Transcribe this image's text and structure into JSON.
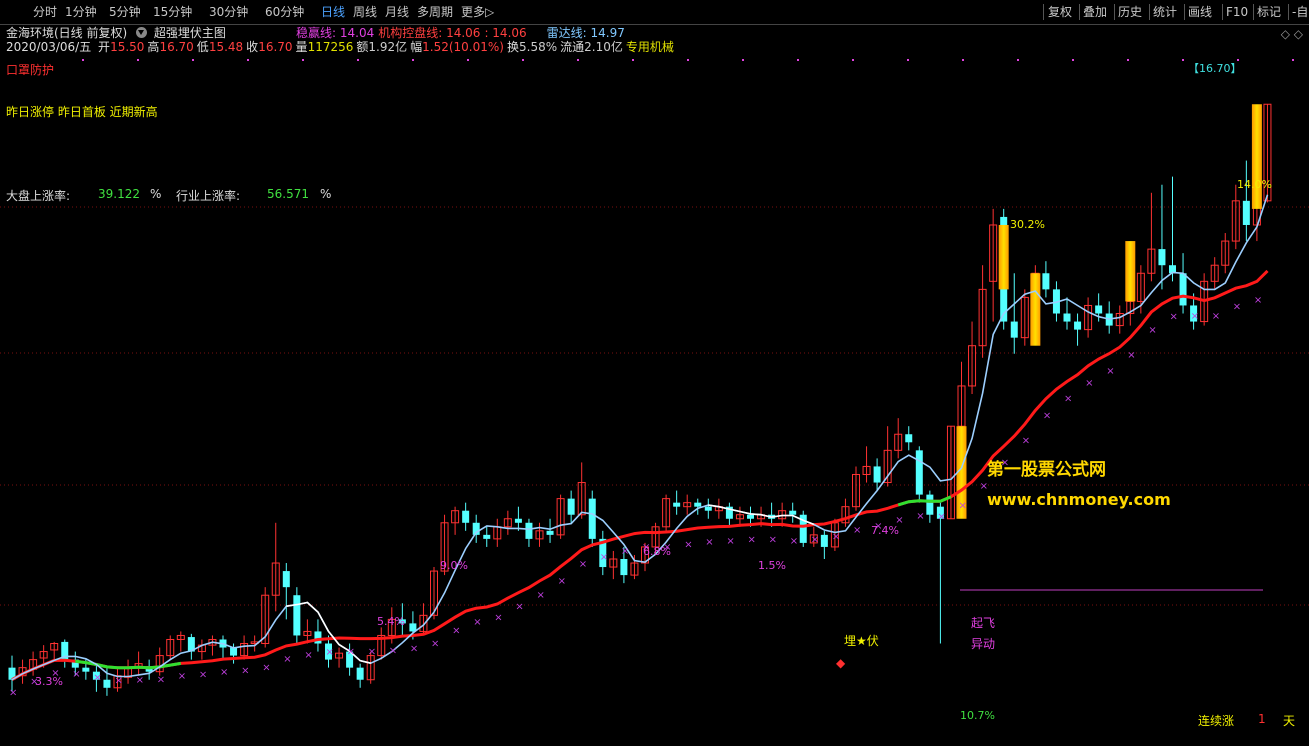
{
  "toolbar": {
    "tabs": [
      "分时",
      "1分钟",
      "5分钟",
      "15分钟",
      "30分钟",
      "60分钟",
      "日线",
      "周线",
      "月线",
      "多周期",
      "更多▷"
    ],
    "active_tab": "日线",
    "right_buttons": [
      "复权",
      "叠加",
      "历史",
      "统计",
      "画线",
      "F10",
      "标记",
      "-自"
    ]
  },
  "header": {
    "stock_name": "金海环境(日线 前复权)",
    "formula_name": "超强埋伏主图",
    "line1": [
      {
        "label": "稳赢线: ",
        "value": "14.04",
        "color": "#e040e0"
      },
      {
        "label": "机构控盘线: ",
        "value": "14.06",
        "color": "#ff4040"
      },
      {
        "label": "",
        "value": ": 14.06",
        "color": "#ff4040"
      },
      {
        "label": "雷达线: ",
        "value": "14.97",
        "color": "#80c8ff"
      }
    ],
    "date": "2020/03/06/五",
    "quote": [
      {
        "label": "开",
        "value": "15.50",
        "color": "#ff4040"
      },
      {
        "label": "高",
        "value": "16.70",
        "color": "#ff4040"
      },
      {
        "label": "低",
        "value": "15.48",
        "color": "#ff4040"
      },
      {
        "label": "收",
        "value": "16.70",
        "color": "#ff4040"
      },
      {
        "label": "量",
        "value": "117256",
        "color": "#e0e000"
      },
      {
        "label": "额",
        "value": "1.92亿",
        "color": "#ccc"
      },
      {
        "label": "幅",
        "value": "1.52(10.01%)",
        "color": "#ff4040"
      },
      {
        "label": "换",
        "value": "5.58%",
        "color": "#ccc"
      },
      {
        "label": "流通",
        "value": "2.10亿",
        "color": "#ccc"
      },
      {
        "label": "",
        "value": "专用机械",
        "color": "#e0e000"
      }
    ]
  },
  "left_notes": {
    "defense": "口罩防护",
    "tags": "昨日涨停 昨日首板 近期新高",
    "market_label": "大盘上涨率:",
    "market_value": "39.122",
    "industry_label": "行业上涨率:",
    "industry_value": "56.571",
    "pct": "%"
  },
  "annotations": {
    "p33": "3.3%",
    "p54": "5.4%",
    "p90": "9.0%",
    "p68": "6.8%",
    "p15": "1.5%",
    "p74": "7.4%",
    "p302": "30.2%",
    "p140": "14.0%",
    "p107": "10.7%",
    "ambush": "埋★伏",
    "takeoff": "起飞",
    "abnormal": "异动",
    "high_price": "16.70",
    "watermark1": "第一股票公式网",
    "watermark2": "www.chnmoney.com",
    "consecutive_label": "连续涨",
    "consecutive_value": "1",
    "consecutive_unit": "天"
  },
  "chart_data": {
    "type": "candlestick",
    "ylim": [
      9.0,
      17.2
    ],
    "candles": [
      {
        "o": 9.7,
        "c": 9.55,
        "h": 9.85,
        "l": 9.4
      },
      {
        "o": 9.6,
        "c": 9.7,
        "h": 9.8,
        "l": 9.5
      },
      {
        "o": 9.68,
        "c": 9.8,
        "h": 9.9,
        "l": 9.6
      },
      {
        "o": 9.82,
        "c": 9.9,
        "h": 9.98,
        "l": 9.7
      },
      {
        "o": 9.92,
        "c": 10.0,
        "h": 10.02,
        "l": 9.8
      },
      {
        "o": 10.02,
        "c": 9.8,
        "h": 10.05,
        "l": 9.7
      },
      {
        "o": 9.8,
        "c": 9.7,
        "h": 9.9,
        "l": 9.6
      },
      {
        "o": 9.7,
        "c": 9.65,
        "h": 9.8,
        "l": 9.55
      },
      {
        "o": 9.65,
        "c": 9.55,
        "h": 9.75,
        "l": 9.4
      },
      {
        "o": 9.55,
        "c": 9.45,
        "h": 9.7,
        "l": 9.35
      },
      {
        "o": 9.45,
        "c": 9.6,
        "h": 9.7,
        "l": 9.4
      },
      {
        "o": 9.58,
        "c": 9.7,
        "h": 9.8,
        "l": 9.5
      },
      {
        "o": 9.7,
        "c": 9.75,
        "h": 9.9,
        "l": 9.6
      },
      {
        "o": 9.72,
        "c": 9.65,
        "h": 9.8,
        "l": 9.55
      },
      {
        "o": 9.65,
        "c": 9.85,
        "h": 9.95,
        "l": 9.6
      },
      {
        "o": 9.85,
        "c": 10.05,
        "h": 10.1,
        "l": 9.8
      },
      {
        "o": 10.05,
        "c": 10.1,
        "h": 10.15,
        "l": 9.9
      },
      {
        "o": 10.08,
        "c": 9.9,
        "h": 10.12,
        "l": 9.8
      },
      {
        "o": 9.9,
        "c": 9.98,
        "h": 10.05,
        "l": 9.8
      },
      {
        "o": 9.98,
        "c": 10.05,
        "h": 10.1,
        "l": 9.85
      },
      {
        "o": 10.05,
        "c": 9.95,
        "h": 10.1,
        "l": 9.8
      },
      {
        "o": 9.95,
        "c": 9.85,
        "h": 10.0,
        "l": 9.75
      },
      {
        "o": 9.85,
        "c": 10.0,
        "h": 10.1,
        "l": 9.8
      },
      {
        "o": 10.0,
        "c": 10.02,
        "h": 10.1,
        "l": 9.9
      },
      {
        "o": 10.0,
        "c": 10.6,
        "h": 10.7,
        "l": 9.95
      },
      {
        "o": 10.6,
        "c": 11.0,
        "h": 11.5,
        "l": 10.4
      },
      {
        "o": 10.9,
        "c": 10.7,
        "h": 11.0,
        "l": 10.3
      },
      {
        "o": 10.6,
        "c": 10.1,
        "h": 10.7,
        "l": 10.0
      },
      {
        "o": 10.1,
        "c": 10.15,
        "h": 10.3,
        "l": 10.0
      },
      {
        "o": 10.15,
        "c": 10.0,
        "h": 10.3,
        "l": 9.9
      },
      {
        "o": 10.0,
        "c": 9.8,
        "h": 10.1,
        "l": 9.7
      },
      {
        "o": 9.82,
        "c": 9.88,
        "h": 9.95,
        "l": 9.7
      },
      {
        "o": 9.9,
        "c": 9.7,
        "h": 10.0,
        "l": 9.6
      },
      {
        "o": 9.7,
        "c": 9.55,
        "h": 9.75,
        "l": 9.45
      },
      {
        "o": 9.55,
        "c": 9.85,
        "h": 9.9,
        "l": 9.5
      },
      {
        "o": 9.85,
        "c": 10.1,
        "h": 10.2,
        "l": 9.8
      },
      {
        "o": 10.1,
        "c": 10.3,
        "h": 10.45,
        "l": 10.0
      },
      {
        "o": 10.3,
        "c": 10.25,
        "h": 10.5,
        "l": 10.1
      },
      {
        "o": 10.25,
        "c": 10.15,
        "h": 10.4,
        "l": 10.05
      },
      {
        "o": 10.15,
        "c": 10.35,
        "h": 10.5,
        "l": 10.1
      },
      {
        "o": 10.35,
        "c": 10.9,
        "h": 10.95,
        "l": 10.3
      },
      {
        "o": 10.9,
        "c": 11.5,
        "h": 11.6,
        "l": 10.85
      },
      {
        "o": 11.5,
        "c": 11.65,
        "h": 11.7,
        "l": 11.35
      },
      {
        "o": 11.65,
        "c": 11.5,
        "h": 11.75,
        "l": 11.4
      },
      {
        "o": 11.5,
        "c": 11.35,
        "h": 11.6,
        "l": 11.25
      },
      {
        "o": 11.35,
        "c": 11.3,
        "h": 11.45,
        "l": 11.2
      },
      {
        "o": 11.3,
        "c": 11.45,
        "h": 11.55,
        "l": 11.2
      },
      {
        "o": 11.45,
        "c": 11.55,
        "h": 11.65,
        "l": 11.35
      },
      {
        "o": 11.55,
        "c": 11.5,
        "h": 11.7,
        "l": 11.4
      },
      {
        "o": 11.5,
        "c": 11.3,
        "h": 11.55,
        "l": 11.2
      },
      {
        "o": 11.3,
        "c": 11.4,
        "h": 11.5,
        "l": 11.2
      },
      {
        "o": 11.4,
        "c": 11.35,
        "h": 11.55,
        "l": 11.25
      },
      {
        "o": 11.35,
        "c": 11.8,
        "h": 11.85,
        "l": 11.3
      },
      {
        "o": 11.8,
        "c": 11.6,
        "h": 11.9,
        "l": 11.5
      },
      {
        "o": 11.6,
        "c": 12.0,
        "h": 12.25,
        "l": 11.55
      },
      {
        "o": 11.8,
        "c": 11.3,
        "h": 11.9,
        "l": 11.2
      },
      {
        "o": 11.3,
        "c": 10.95,
        "h": 11.4,
        "l": 10.85
      },
      {
        "o": 10.95,
        "c": 11.05,
        "h": 11.15,
        "l": 10.8
      },
      {
        "o": 11.05,
        "c": 10.85,
        "h": 11.2,
        "l": 10.75
      },
      {
        "o": 10.85,
        "c": 11.0,
        "h": 11.1,
        "l": 10.8
      },
      {
        "o": 11.0,
        "c": 11.2,
        "h": 11.25,
        "l": 10.9
      },
      {
        "o": 11.2,
        "c": 11.45,
        "h": 11.5,
        "l": 11.1
      },
      {
        "o": 11.45,
        "c": 11.8,
        "h": 11.85,
        "l": 11.4
      },
      {
        "o": 11.75,
        "c": 11.7,
        "h": 11.9,
        "l": 11.6
      },
      {
        "o": 11.7,
        "c": 11.75,
        "h": 11.85,
        "l": 11.6
      },
      {
        "o": 11.75,
        "c": 11.7,
        "h": 11.8,
        "l": 11.6
      },
      {
        "o": 11.7,
        "c": 11.65,
        "h": 11.8,
        "l": 11.55
      },
      {
        "o": 11.65,
        "c": 11.7,
        "h": 11.8,
        "l": 11.55
      },
      {
        "o": 11.7,
        "c": 11.55,
        "h": 11.75,
        "l": 11.45
      },
      {
        "o": 11.55,
        "c": 11.6,
        "h": 11.7,
        "l": 11.45
      },
      {
        "o": 11.6,
        "c": 11.55,
        "h": 11.7,
        "l": 11.45
      },
      {
        "o": 11.55,
        "c": 11.6,
        "h": 11.7,
        "l": 11.45
      },
      {
        "o": 11.6,
        "c": 11.55,
        "h": 11.75,
        "l": 11.45
      },
      {
        "o": 11.55,
        "c": 11.65,
        "h": 11.75,
        "l": 11.45
      },
      {
        "o": 11.65,
        "c": 11.6,
        "h": 11.75,
        "l": 11.5
      },
      {
        "o": 11.6,
        "c": 11.25,
        "h": 11.65,
        "l": 11.2
      },
      {
        "o": 11.25,
        "c": 11.35,
        "h": 11.45,
        "l": 11.2
      },
      {
        "o": 11.35,
        "c": 11.2,
        "h": 11.4,
        "l": 11.05
      },
      {
        "o": 11.2,
        "c": 11.5,
        "h": 11.55,
        "l": 11.15
      },
      {
        "o": 11.5,
        "c": 11.7,
        "h": 11.8,
        "l": 11.45
      },
      {
        "o": 11.7,
        "c": 12.1,
        "h": 12.2,
        "l": 11.65
      },
      {
        "o": 12.1,
        "c": 12.2,
        "h": 12.45,
        "l": 12.0
      },
      {
        "o": 12.2,
        "c": 12.0,
        "h": 12.3,
        "l": 11.9
      },
      {
        "o": 12.0,
        "c": 12.4,
        "h": 12.7,
        "l": 11.95
      },
      {
        "o": 12.4,
        "c": 12.6,
        "h": 12.8,
        "l": 12.3
      },
      {
        "o": 12.6,
        "c": 12.5,
        "h": 12.7,
        "l": 12.4
      },
      {
        "o": 12.4,
        "c": 11.85,
        "h": 12.45,
        "l": 11.75
      },
      {
        "o": 11.85,
        "c": 11.6,
        "h": 11.9,
        "l": 11.5
      },
      {
        "o": 11.7,
        "c": 11.55,
        "h": 11.75,
        "l": 10.0
      },
      {
        "o": 11.55,
        "c": 12.7,
        "h": 12.7,
        "l": 11.55
      },
      {
        "o": 12.7,
        "c": 13.2,
        "h": 13.5,
        "l": 12.6
      },
      {
        "o": 13.2,
        "c": 13.7,
        "h": 14.0,
        "l": 13.1
      },
      {
        "o": 13.7,
        "c": 14.4,
        "h": 14.7,
        "l": 13.55
      },
      {
        "o": 14.5,
        "c": 15.2,
        "h": 15.4,
        "l": 14.0
      },
      {
        "o": 15.3,
        "c": 14.0,
        "h": 15.4,
        "l": 13.9
      },
      {
        "o": 14.0,
        "c": 13.8,
        "h": 14.6,
        "l": 13.6
      },
      {
        "o": 13.8,
        "c": 14.3,
        "h": 14.4,
        "l": 13.7
      },
      {
        "o": 14.3,
        "c": 14.6,
        "h": 14.7,
        "l": 14.1
      },
      {
        "o": 14.6,
        "c": 14.4,
        "h": 14.75,
        "l": 14.3
      },
      {
        "o": 14.4,
        "c": 14.1,
        "h": 14.5,
        "l": 14.0
      },
      {
        "o": 14.1,
        "c": 14.0,
        "h": 14.3,
        "l": 13.9
      },
      {
        "o": 14.0,
        "c": 13.9,
        "h": 14.1,
        "l": 13.7
      },
      {
        "o": 13.9,
        "c": 14.2,
        "h": 14.3,
        "l": 13.8
      },
      {
        "o": 14.2,
        "c": 14.1,
        "h": 14.35,
        "l": 14.0
      },
      {
        "o": 14.1,
        "c": 13.95,
        "h": 14.25,
        "l": 13.85
      },
      {
        "o": 13.95,
        "c": 14.1,
        "h": 14.2,
        "l": 13.85
      },
      {
        "o": 14.1,
        "c": 14.25,
        "h": 14.4,
        "l": 13.95
      },
      {
        "o": 14.25,
        "c": 14.6,
        "h": 14.7,
        "l": 14.1
      },
      {
        "o": 14.6,
        "c": 14.9,
        "h": 15.6,
        "l": 14.5
      },
      {
        "o": 14.9,
        "c": 14.7,
        "h": 15.7,
        "l": 14.4
      },
      {
        "o": 14.7,
        "c": 14.6,
        "h": 15.8,
        "l": 14.5
      },
      {
        "o": 14.6,
        "c": 14.2,
        "h": 14.85,
        "l": 14.1
      },
      {
        "o": 14.2,
        "c": 14.0,
        "h": 14.35,
        "l": 13.9
      },
      {
        "o": 14.0,
        "c": 14.5,
        "h": 14.6,
        "l": 13.95
      },
      {
        "o": 14.5,
        "c": 14.7,
        "h": 14.8,
        "l": 14.4
      },
      {
        "o": 14.7,
        "c": 15.0,
        "h": 15.1,
        "l": 14.6
      },
      {
        "o": 15.0,
        "c": 15.5,
        "h": 15.7,
        "l": 14.9
      },
      {
        "o": 15.5,
        "c": 15.2,
        "h": 16.0,
        "l": 15.0
      },
      {
        "o": 15.2,
        "c": 15.48,
        "h": 16.0,
        "l": 15.0
      },
      {
        "o": 15.5,
        "c": 16.7,
        "h": 16.7,
        "l": 15.48
      }
    ],
    "yellow_bars": [
      {
        "i": 90,
        "from": 11.55,
        "to": 12.7
      },
      {
        "i": 94,
        "from": 14.4,
        "to": 15.2
      },
      {
        "i": 97,
        "from": 13.7,
        "to": 14.6
      },
      {
        "i": 106,
        "from": 14.25,
        "to": 15.0
      },
      {
        "i": 118,
        "from": 15.4,
        "to": 16.7
      }
    ]
  }
}
